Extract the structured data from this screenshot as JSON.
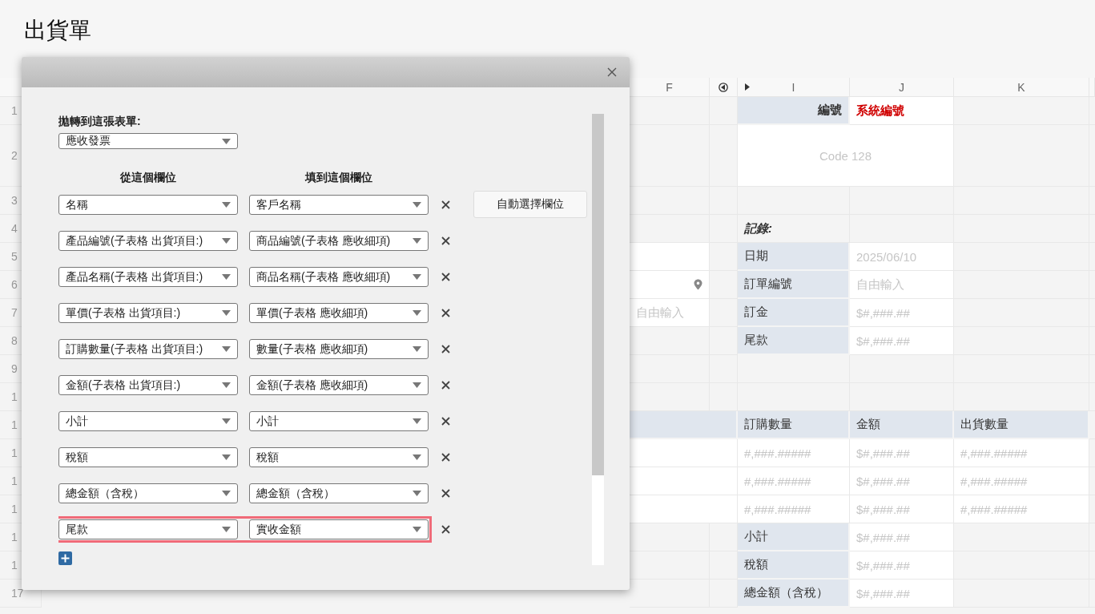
{
  "page": {
    "title": "出貨單"
  },
  "sheet": {
    "columns": [
      "F",
      "I",
      "J",
      "K"
    ],
    "rows": [
      {
        "number": "1",
        "kind": "normal",
        "i": {
          "kind": "key-label",
          "text": "編號"
        },
        "j": {
          "kind": "system",
          "text": "系統編號"
        }
      },
      {
        "number": "2",
        "kind": "tall",
        "i": {
          "kind": "barcode",
          "text": "Code 128"
        }
      },
      {
        "number": "3",
        "kind": "normal"
      },
      {
        "number": "4",
        "kind": "normal",
        "i": {
          "kind": "note",
          "text": "記錄:"
        }
      },
      {
        "number": "5",
        "kind": "normal",
        "f": {
          "kind": "field"
        },
        "i": {
          "kind": "label",
          "text": "日期"
        },
        "j": {
          "kind": "field",
          "placeholder": "2025/06/10"
        }
      },
      {
        "number": "6",
        "kind": "normal",
        "f": {
          "kind": "location-field"
        },
        "i": {
          "kind": "label",
          "text": "訂單編號"
        },
        "j": {
          "kind": "field",
          "placeholder": "自由輸入"
        }
      },
      {
        "number": "7",
        "kind": "normal",
        "f": {
          "kind": "field",
          "placeholder": "自由輸入"
        },
        "i": {
          "kind": "label",
          "text": "訂金"
        },
        "j": {
          "kind": "field",
          "placeholder": "$#,###.##"
        }
      },
      {
        "number": "8",
        "kind": "normal",
        "i": {
          "kind": "label",
          "text": "尾款"
        },
        "j": {
          "kind": "field",
          "placeholder": "$#,###.##"
        }
      },
      {
        "number": "9",
        "kind": "normal"
      },
      {
        "number": "1",
        "kind": "normal"
      },
      {
        "number": "1",
        "kind": "normal",
        "f": {
          "kind": "header"
        },
        "i": {
          "kind": "header",
          "text": "訂購數量"
        },
        "j": {
          "kind": "header",
          "text": "金額"
        },
        "k": {
          "kind": "header",
          "text": "出貨數量"
        }
      },
      {
        "number": "1",
        "kind": "normal",
        "f": {
          "kind": "table-field"
        },
        "i": {
          "kind": "field",
          "placeholder": "#,###.#####"
        },
        "j": {
          "kind": "field",
          "placeholder": "$#,###.##"
        },
        "k": {
          "kind": "field",
          "placeholder": "#,###.#####"
        }
      },
      {
        "number": "1",
        "kind": "normal",
        "f": {
          "kind": "table-field"
        },
        "i": {
          "kind": "field",
          "placeholder": "#,###.#####"
        },
        "j": {
          "kind": "field",
          "placeholder": "$#,###.##"
        },
        "k": {
          "kind": "field",
          "placeholder": "#,###.#####"
        }
      },
      {
        "number": "1",
        "kind": "normal",
        "f": {
          "kind": "table-field"
        },
        "i": {
          "kind": "field",
          "placeholder": "#,###.#####"
        },
        "j": {
          "kind": "field",
          "placeholder": "$#,###.##"
        },
        "k": {
          "kind": "field",
          "placeholder": "#,###.#####"
        }
      },
      {
        "number": "1",
        "kind": "normal",
        "i": {
          "kind": "label",
          "text": "小計"
        },
        "j": {
          "kind": "field",
          "placeholder": "$#,###.##"
        }
      },
      {
        "number": "1",
        "kind": "normal",
        "i": {
          "kind": "label",
          "text": "稅額"
        },
        "j": {
          "kind": "field",
          "placeholder": "$#,###.##"
        }
      },
      {
        "number": "17",
        "kind": "normal",
        "i": {
          "kind": "label",
          "text": "總金額（含稅）"
        },
        "j": {
          "kind": "field",
          "placeholder": "$#,###.##"
        }
      }
    ]
  },
  "dialog": {
    "target_label": "拋轉到這張表單:",
    "target_form": "應收發票",
    "from_heading": "從這個欄位",
    "to_heading": "填到這個欄位",
    "auto_button": "自動選擇欄位",
    "mappings": [
      {
        "from": "名稱",
        "to": "客戶名稱",
        "highlighted": false
      },
      {
        "from": "產品編號(子表格 出貨項目:)",
        "to": "商品編號(子表格 應收細項)",
        "highlighted": false
      },
      {
        "from": "產品名稱(子表格 出貨項目:)",
        "to": "商品名稱(子表格 應收細項)",
        "highlighted": false
      },
      {
        "from": "單價(子表格 出貨項目:)",
        "to": "單價(子表格 應收細項)",
        "highlighted": false
      },
      {
        "from": "訂購數量(子表格 出貨項目:)",
        "to": "數量(子表格 應收細項)",
        "highlighted": false
      },
      {
        "from": "金額(子表格 出貨項目:)",
        "to": "金額(子表格 應收細項)",
        "highlighted": false
      },
      {
        "from": "小計",
        "to": "小計",
        "highlighted": false
      },
      {
        "from": "稅額",
        "to": "稅額",
        "highlighted": false
      },
      {
        "from": "總金額（含稅）",
        "to": "總金額（含稅）",
        "highlighted": false
      },
      {
        "from": "尾款",
        "to": "實收金額",
        "highlighted": true
      }
    ]
  }
}
